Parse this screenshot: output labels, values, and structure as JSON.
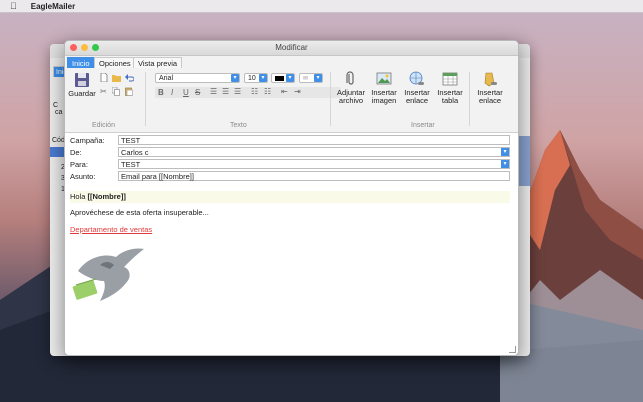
{
  "menubar": {
    "app_name": "EagleMailer"
  },
  "background_window": {
    "tab_label": "Inici",
    "toolbar_label_1": "C",
    "toolbar_label_2": "ca",
    "column_header": "Cód",
    "row_numbers": [
      "2",
      "3",
      "1"
    ]
  },
  "window": {
    "title": "Modificar"
  },
  "tabs": [
    {
      "label": "Inicio",
      "active": true
    },
    {
      "label": "Opciones",
      "active": false
    },
    {
      "label": "Vista previa",
      "active": false
    }
  ],
  "ribbon": {
    "save_label": "Guardar",
    "groups": {
      "edicion": "Edición",
      "texto": "Texto",
      "insertar": "Insertar"
    },
    "font_name": "Arial",
    "font_size": "10",
    "insert_buttons": [
      {
        "line1": "Adjuntar",
        "line2": "archivo"
      },
      {
        "line1": "Insertar",
        "line2": "imagen"
      },
      {
        "line1": "Insertar",
        "line2": "enlace"
      },
      {
        "line1": "Insertar",
        "line2": "tabla"
      },
      {
        "line1": "Insertar",
        "line2": "enlace"
      }
    ]
  },
  "form": {
    "campana_label": "Campaña:",
    "campana_value": "TEST",
    "de_label": "De:",
    "de_value": "Carlos c",
    "para_label": "Para:",
    "para_value": "TEST",
    "asunto_label": "Asunto:",
    "asunto_value": "Email para [[Nombre]]"
  },
  "body": {
    "greeting_prefix": "Hola ",
    "greeting_token": "[[Nombre]]",
    "line2": "Aprovéchese de esta oferta insuperable...",
    "link_text": "Departamento de ventas"
  },
  "colors": {
    "accent": "#3f8fe8",
    "link": "#e23a3a"
  }
}
